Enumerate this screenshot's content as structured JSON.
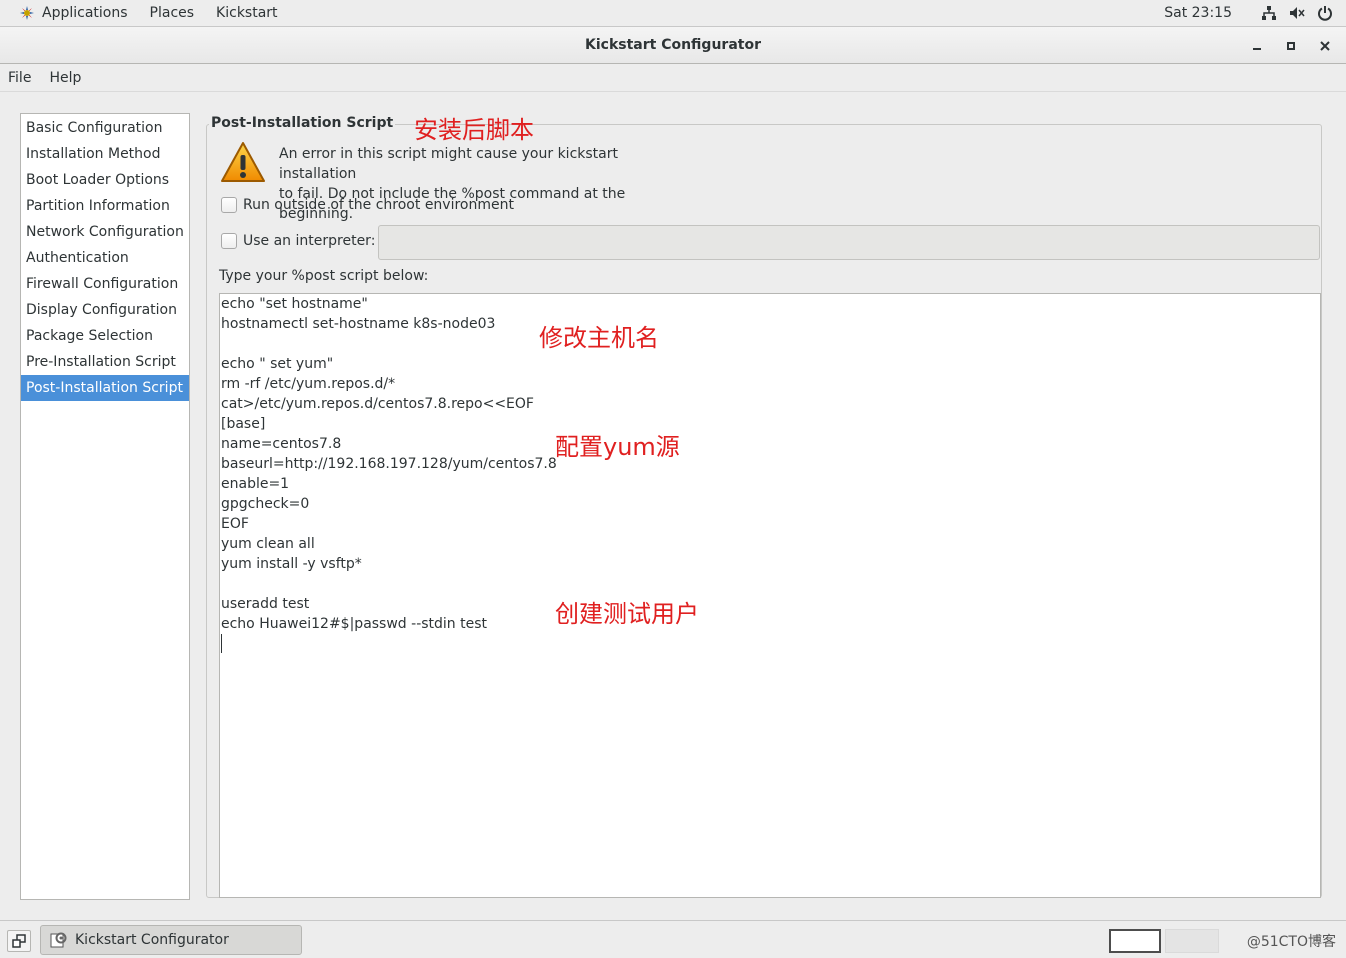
{
  "top_panel": {
    "applications": "Applications",
    "places": "Places",
    "kickstart": "Kickstart",
    "clock": "Sat 23:15"
  },
  "window": {
    "title": "Kickstart Configurator"
  },
  "menubar": {
    "file": "File",
    "help": "Help"
  },
  "sidebar": {
    "items": [
      {
        "label": "Basic Configuration"
      },
      {
        "label": "Installation Method"
      },
      {
        "label": "Boot Loader Options"
      },
      {
        "label": "Partition Information"
      },
      {
        "label": "Network Configuration"
      },
      {
        "label": "Authentication"
      },
      {
        "label": "Firewall Configuration"
      },
      {
        "label": "Display Configuration"
      },
      {
        "label": "Package Selection"
      },
      {
        "label": "Pre-Installation Script"
      },
      {
        "label": "Post-Installation Script"
      }
    ],
    "selected": "Post-Installation Script"
  },
  "main": {
    "frame_title": "Post-Installation Script",
    "warning_line1": "An error in this script might cause your kickstart installation",
    "warning_line2": "to fail. Do not include the %post command at the beginning.",
    "chroot_label": "Run outside of the chroot environment",
    "interpreter_label": "Use an interpreter:",
    "interpreter_value": "",
    "script_label": "Type your %post script below:",
    "script_lines": [
      "echo \"set hostname\"",
      "hostnamectl set-hostname k8s-node03",
      "",
      "echo \" set yum\"",
      "rm -rf /etc/yum.repos.d/*",
      "cat>/etc/yum.repos.d/centos7.8.repo<<EOF",
      "[base]",
      "name=centos7.8",
      "baseurl=http://192.168.197.128/yum/centos7.8",
      "enable=1",
      "gpgcheck=0",
      "EOF",
      "yum clean all",
      "yum install -y vsftp*",
      "",
      "useradd test",
      "echo Huawei12#$|passwd --stdin test"
    ]
  },
  "annotations": {
    "post_script": "安装后脚本",
    "hostname": "修改主机名",
    "yum": "配置yum源",
    "user": "创建测试用户"
  },
  "taskbar": {
    "task_label": "Kickstart Configurator",
    "watermark": "@51CTO博客"
  },
  "colors": {
    "selection": "#4a90d9",
    "annotation": "#e02020"
  }
}
